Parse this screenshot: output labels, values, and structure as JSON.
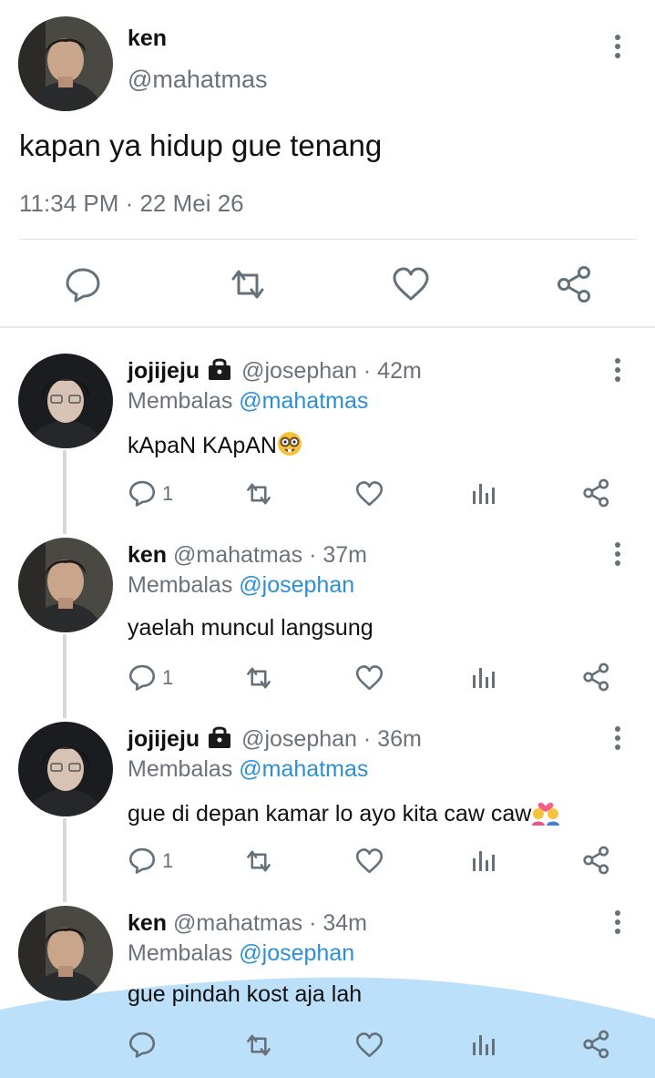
{
  "main_tweet": {
    "display_name": "ken",
    "handle": "@mahatmas",
    "text": "kapan ya hidup gue tenang",
    "timestamp": "11:34 PM · 22 Mei 26"
  },
  "replies": [
    {
      "display_name": "jojijeju",
      "locked": true,
      "handle": "@josephan",
      "age": "· 42m",
      "replying_label": "Membalas",
      "replying_to": "@mahatmas",
      "text": "kApaN KApAN",
      "emoji": "nerd-face",
      "reply_count": "1"
    },
    {
      "display_name": "ken",
      "locked": false,
      "handle": "@mahatmas",
      "age": "· 37m",
      "replying_label": "Membalas",
      "replying_to": "@josephan",
      "text": "yaelah muncul langsung",
      "reply_count": "1"
    },
    {
      "display_name": "jojijeju",
      "locked": true,
      "handle": "@josephan",
      "age": "· 36m",
      "replying_label": "Membalas",
      "replying_to": "@mahatmas",
      "text": "gue di depan kamar lo ayo kita caw caw",
      "emoji": "couple-with-heart",
      "reply_count": "1"
    },
    {
      "display_name": "ken",
      "locked": false,
      "handle": "@mahatmas",
      "age": "· 34m",
      "replying_label": "Membalas",
      "replying_to": "@josephan",
      "text": "gue pindah kost aja lah",
      "reply_count": ""
    }
  ],
  "icons": [
    "reply-icon",
    "retweet-icon",
    "like-icon",
    "share-icon",
    "analytics-icon",
    "lock-icon",
    "more-icon"
  ],
  "colors": {
    "link": "#2c8fd6",
    "muted": "#6b7279",
    "icon": "#64707a",
    "wave": "#bde0fa"
  }
}
